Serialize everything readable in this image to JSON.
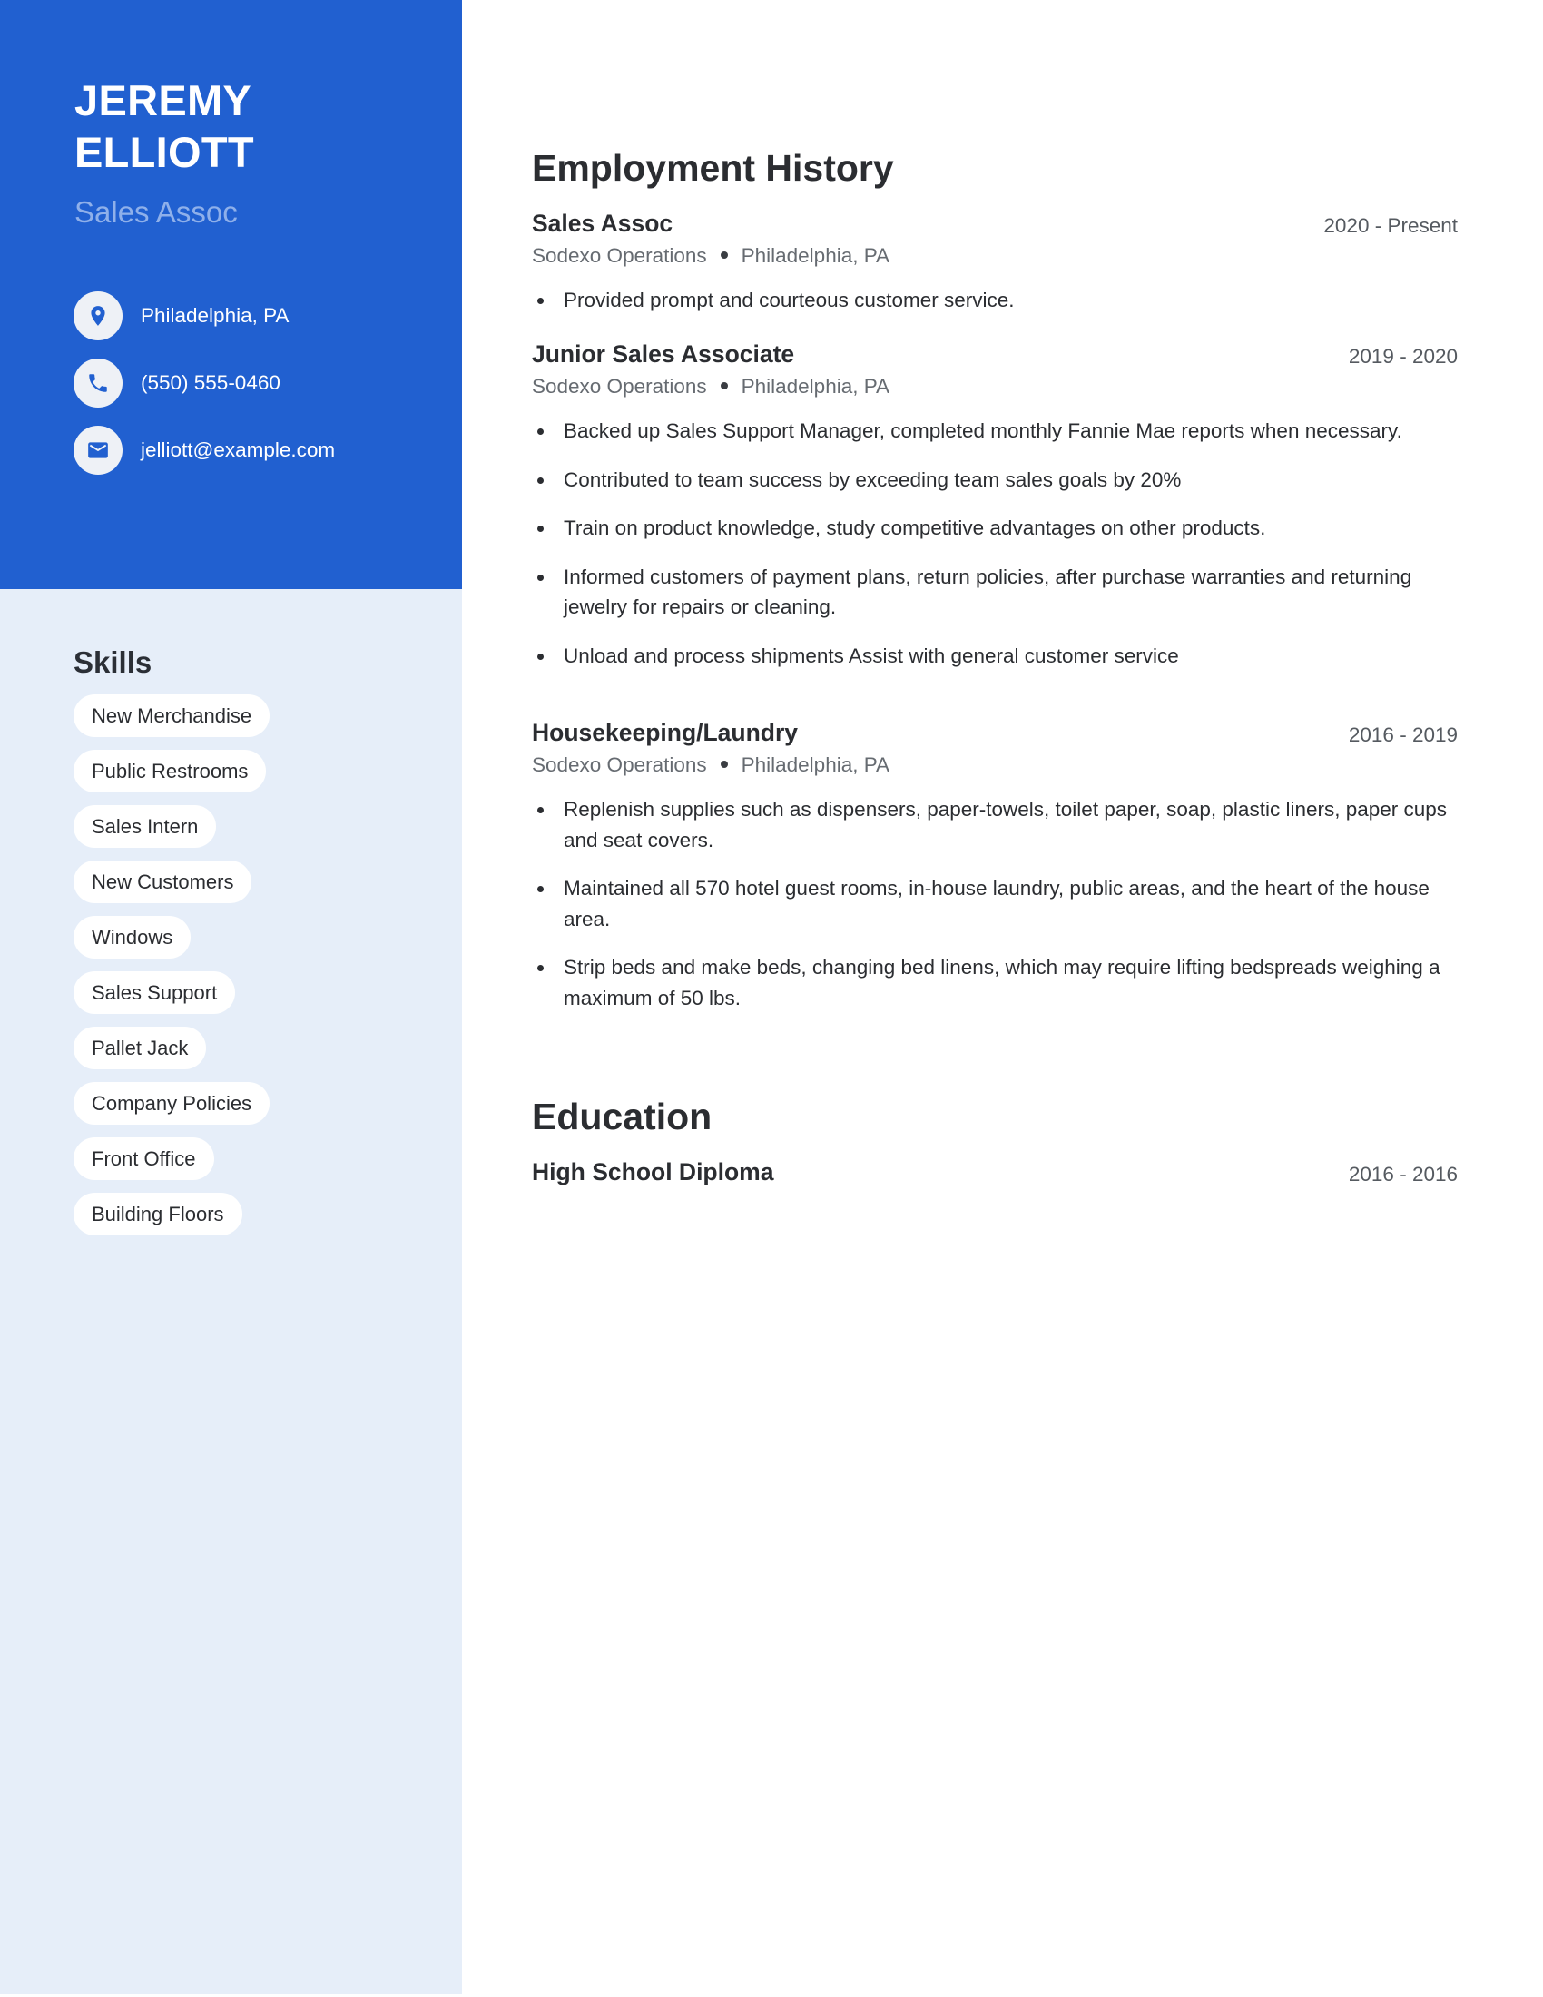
{
  "profile": {
    "first_name": "JEREMY",
    "last_name": "ELLIOTT",
    "job_title": "Sales Assoc"
  },
  "contacts": [
    {
      "icon": "location-pin-icon",
      "text": "Philadelphia, PA"
    },
    {
      "icon": "phone-icon",
      "text": "(550) 555-0460"
    },
    {
      "icon": "email-icon",
      "text": "jelliott@example.com"
    }
  ],
  "skills": {
    "title": "Skills",
    "items": [
      "New Merchandise",
      "Public Restrooms",
      "Sales Intern",
      "New Customers",
      "Windows",
      "Sales Support",
      "Pallet Jack",
      "Company Policies",
      "Front Office",
      "Building Floors"
    ]
  },
  "employment": {
    "title": "Employment History",
    "jobs": [
      {
        "role": "Sales Assoc",
        "dates": "2020 - Present",
        "company": "Sodexo Operations",
        "location": "Philadelphia, PA",
        "bullets": [
          "Provided prompt and courteous customer service."
        ]
      },
      {
        "role": "Junior Sales Associate",
        "dates": "2019 - 2020",
        "company": "Sodexo Operations",
        "location": "Philadelphia, PA",
        "bullets": [
          "Backed up Sales Support Manager, completed monthly Fannie Mae reports when necessary.",
          "Contributed to team success by exceeding team sales goals by 20%",
          "Train on product knowledge, study competitive advantages on other products.",
          "Informed customers of payment plans, return policies, after purchase warranties and returning jewelry for repairs or cleaning.",
          "Unload and process shipments Assist with general customer service"
        ]
      },
      {
        "role": "Housekeeping/Laundry",
        "dates": "2016 - 2019",
        "company": "Sodexo Operations",
        "location": "Philadelphia, PA",
        "bullets": [
          "Replenish supplies such as dispensers, paper-towels, toilet paper, soap, plastic liners, paper cups and seat covers.",
          "Maintained all 570 hotel guest rooms, in-house laundry, public areas, and the heart of the house area.",
          "Strip beds and make beds, changing bed linens, which may require lifting bedspreads weighing a maximum of 50 lbs."
        ]
      }
    ]
  },
  "education": {
    "title": "Education",
    "entries": [
      {
        "degree": "High School Diploma",
        "dates": "2016 - 2016"
      }
    ]
  },
  "colors": {
    "accent_blue": "#2160d0",
    "sidebar_light": "#e6eef9",
    "job_title_light_blue": "#8fb0ea",
    "text_dark": "#2b2d31",
    "text_grey": "#666b71"
  }
}
